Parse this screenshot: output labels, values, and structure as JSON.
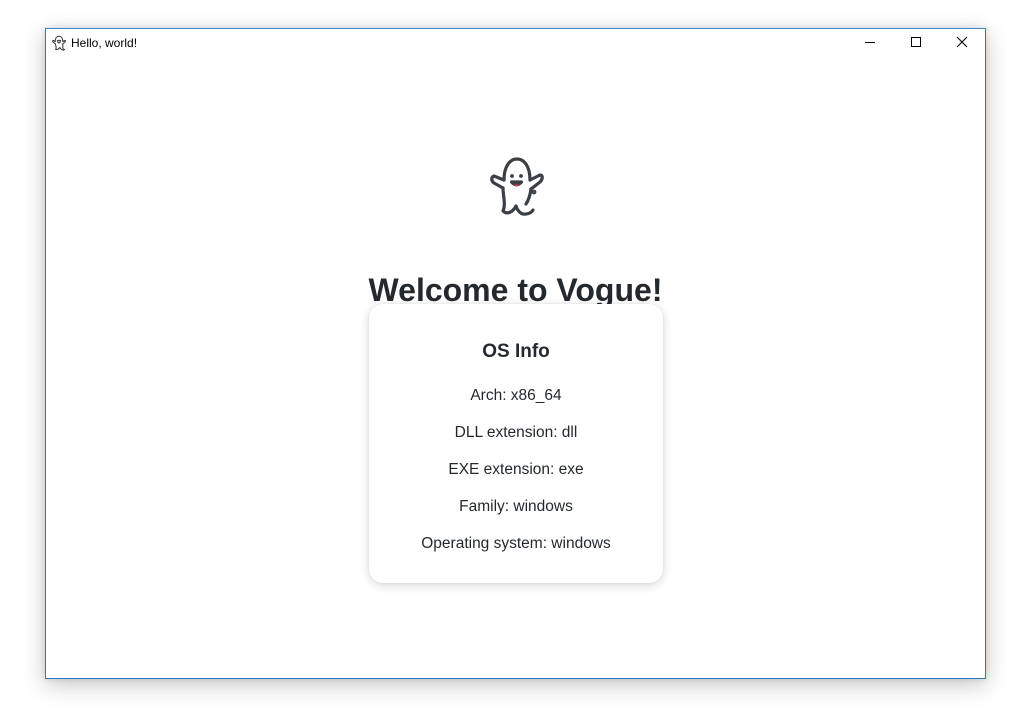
{
  "window": {
    "title": "Hello, world!",
    "icon": "ghost-icon",
    "controls": {
      "minimize": "minimize-icon",
      "maximize": "maximize-icon",
      "close": "close-icon"
    },
    "border_color": "#2b78c9"
  },
  "main": {
    "logo": "ghost-icon",
    "heading": "Welcome to Vogue!",
    "os_info": {
      "title": "OS Info",
      "rows": [
        "Arch: x86_64",
        "DLL extension: dll",
        "EXE extension: exe",
        "Family: windows",
        "Operating system: windows"
      ]
    }
  },
  "colors": {
    "text": "#24292f",
    "ghost_tongue": "#e0314b"
  }
}
